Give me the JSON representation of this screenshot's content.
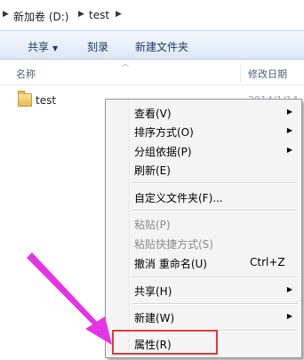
{
  "address": {
    "drive": "新加卷 (D:)",
    "folder": "test"
  },
  "toolbar": {
    "share": "共享",
    "burn": "刻录",
    "new_folder": "新建文件夹"
  },
  "columns": {
    "name": "名称",
    "modified": "修改日期"
  },
  "file": {
    "name": "test",
    "date": "2014/1/14"
  },
  "menu": {
    "view": "查看(V)",
    "sort": "排序方式(O)",
    "group": "分组依据(P)",
    "refresh": "刷新(E)",
    "customize": "自定义文件夹(F)...",
    "paste": "粘贴(P)",
    "paste_shortcut": "粘贴快捷方式(S)",
    "undo": "撤消 重命名(U)",
    "undo_shortcut": "Ctrl+Z",
    "share": "共享(H)",
    "new": "新建(W)",
    "properties": "属性(R)"
  },
  "colors": {
    "highlight": "#e03b3b",
    "pointer": "#e534e5"
  }
}
